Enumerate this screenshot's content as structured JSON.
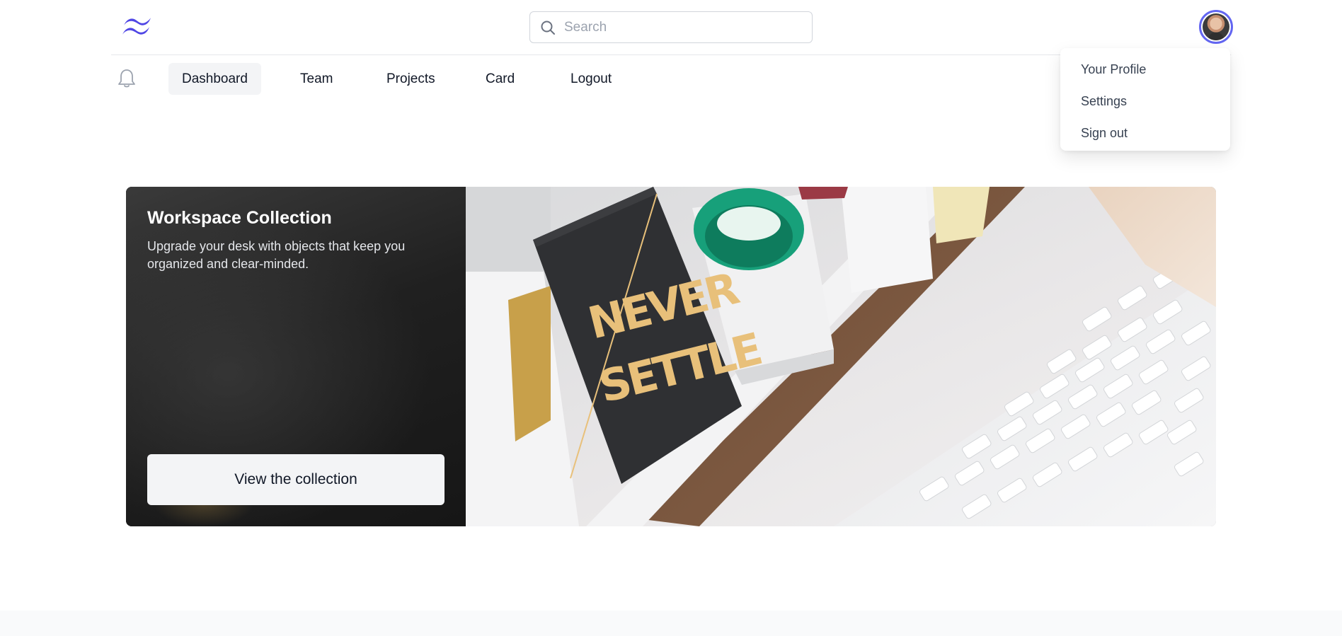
{
  "header": {
    "logo_icon": "tailwind-logo-icon",
    "search": {
      "placeholder": "Search",
      "value": "",
      "icon": "search-icon"
    },
    "avatar_icon": "user-avatar"
  },
  "nav": {
    "bell_icon": "bell-icon",
    "items": [
      {
        "label": "Dashboard",
        "active": true
      },
      {
        "label": "Team",
        "active": false
      },
      {
        "label": "Projects",
        "active": false
      },
      {
        "label": "Card",
        "active": false
      },
      {
        "label": "Logout",
        "active": false
      }
    ]
  },
  "profile_menu": {
    "items": [
      {
        "label": "Your Profile"
      },
      {
        "label": "Settings"
      },
      {
        "label": "Sign out"
      }
    ]
  },
  "hero": {
    "title": "Workspace Collection",
    "description": "Upgrade your desk with objects that keep you organized and clear-minded.",
    "button_label": "View the collection",
    "image_card_text_line1": "NEVER",
    "image_card_text_line2": "SETTLE"
  },
  "colors": {
    "accent": "#6366f1",
    "nav_active_bg": "#f3f4f6",
    "hero_left_bg": "#1f1f1f",
    "button_bg": "#f3f4f6",
    "card_gold": "#e8c07a"
  }
}
